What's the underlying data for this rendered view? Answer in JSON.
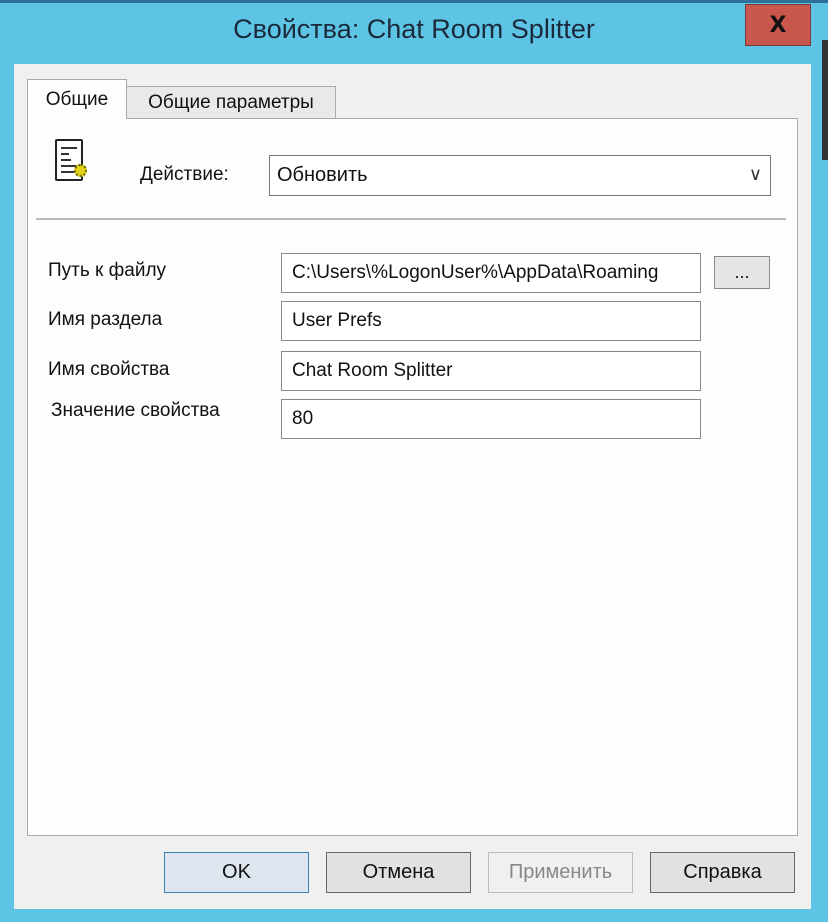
{
  "window": {
    "title": "Свойства: Chat Room Splitter",
    "close_label": "X"
  },
  "tabs": [
    {
      "label": "Общие",
      "active": true
    },
    {
      "label": "Общие параметры",
      "active": false
    }
  ],
  "action": {
    "label": "Действие:",
    "value": "Обновить",
    "icon": "ini-file-icon"
  },
  "fields": [
    {
      "label": "Путь к файлу",
      "value": "C:\\Users\\%LogonUser%\\AppData\\Roaming"
    },
    {
      "label": "Имя раздела",
      "value": "User Prefs"
    },
    {
      "label": "Имя свойства",
      "value": "Chat Room Splitter"
    },
    {
      "label": "Значение свойства",
      "value": "80"
    }
  ],
  "browse_label": "...",
  "buttons": {
    "ok": "OK",
    "cancel": "Отмена",
    "apply": "Применить",
    "help": "Справка"
  },
  "colors": {
    "frame": "#5ec4e6",
    "close": "#c9574e"
  }
}
